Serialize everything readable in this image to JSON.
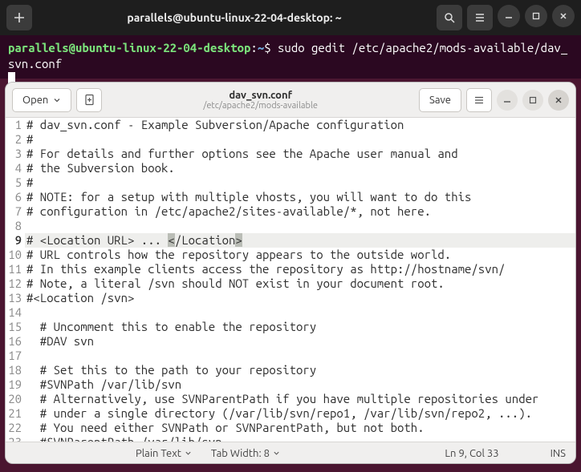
{
  "terminal": {
    "titlebar": {
      "title": "parallels@ubuntu-linux-22-04-desktop: ~"
    },
    "prompt": {
      "user": "parallels@ubuntu-linux-22-04-desktop",
      "sep": ":",
      "path": "~",
      "dollar": "$",
      "command": " sudo gedit /etc/apache2/mods-available/dav_svn.conf"
    }
  },
  "gedit": {
    "header": {
      "open_label": "Open",
      "save_label": "Save",
      "doc_title": "dav_svn.conf",
      "doc_path": "/etc/apache2/mods-available"
    },
    "lines": [
      "# dav_svn.conf - Example Subversion/Apache configuration",
      "#",
      "# For details and further options see the Apache user manual and",
      "# the Subversion book.",
      "#",
      "# NOTE: for a setup with multiple vhosts, you will want to do this",
      "# configuration in /etc/apache2/sites-available/*, not here.",
      "",
      "# <Location URL> ... </Location>",
      "# URL controls how the repository appears to the outside world.",
      "# In this example clients access the repository as http://hostname/svn/",
      "# Note, a literal /svn should NOT exist in your document root.",
      "#<Location /svn>",
      "",
      "  # Uncomment this to enable the repository",
      "  #DAV svn",
      "",
      "  # Set this to the path to your repository",
      "  #SVNPath /var/lib/svn",
      "  # Alternatively, use SVNParentPath if you have multiple repositories under",
      "  # under a single directory (/var/lib/svn/repo1, /var/lib/svn/repo2, ...).",
      "  # You need either SVNPath or SVNParentPath, but not both.",
      "  #SVNParentPath /var/lib/svn"
    ],
    "current_line_index": 8,
    "statusbar": {
      "syntax": "Plain Text",
      "tab_width": "Tab Width: 8",
      "cursor": "Ln 9, Col 33",
      "mode": "INS"
    }
  }
}
